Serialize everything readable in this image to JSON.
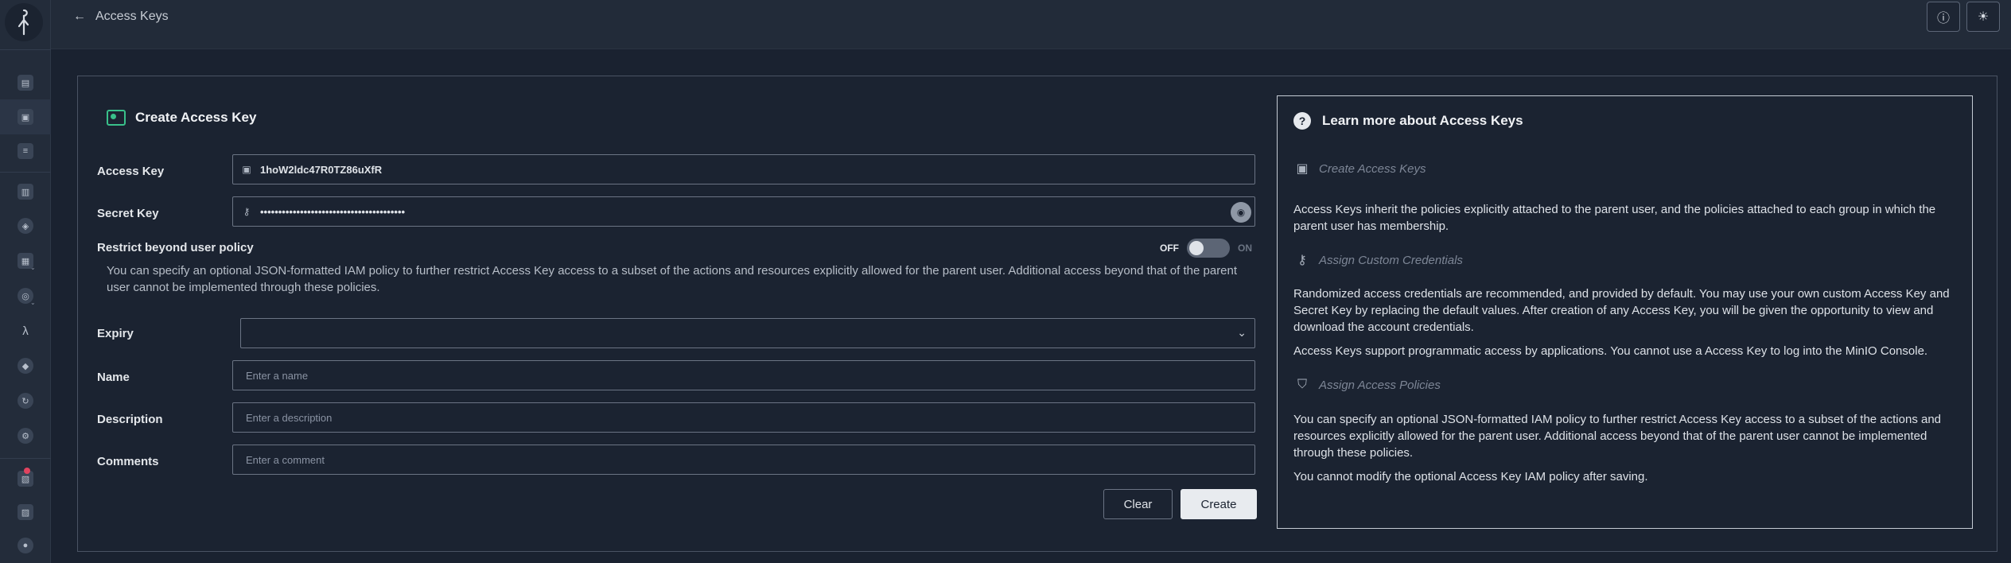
{
  "header": {
    "back_label": "Access Keys"
  },
  "form": {
    "title": "Create Access Key",
    "access_key_label": "Access Key",
    "access_key_value": "1hoW2ldc47R0TZ86uXfR",
    "secret_key_label": "Secret Key",
    "secret_key_value": "••••••••••••••••••••••••••••••••••••••••",
    "restrict_title": "Restrict beyond user policy",
    "restrict_desc": "You can specify an optional JSON-formatted IAM policy to further restrict Access Key access to a subset of the actions and resources explicitly allowed for the parent user. Additional access beyond that of the parent user cannot be implemented through these policies.",
    "toggle_off": "OFF",
    "toggle_on": "ON",
    "expiry_label": "Expiry",
    "name_label": "Name",
    "name_placeholder": "Enter a name",
    "description_label": "Description",
    "description_placeholder": "Enter a description",
    "comments_label": "Comments",
    "comments_placeholder": "Enter a comment",
    "clear_button": "Clear",
    "create_button": "Create"
  },
  "help": {
    "title": "Learn more about Access Keys",
    "section1_title": "Create Access Keys",
    "section1_p1": "Access Keys inherit the policies explicitly attached to the parent user, and the policies attached to each group in which the parent user has membership.",
    "section2_title": "Assign Custom Credentials",
    "section2_p1": "Randomized access credentials are recommended, and provided by default. You may use your own custom Access Key and Secret Key by replacing the default values. After creation of any Access Key, you will be given the opportunity to view and download the account credentials.",
    "section2_p2": "Access Keys support programmatic access by applications. You cannot use a Access Key to log into the MinIO Console.",
    "section3_title": "Assign Access Policies",
    "section3_p1": "You can specify an optional JSON-formatted IAM policy to further restrict Access Key access to a subset of the actions and resources explicitly allowed for the parent user. Additional access beyond that of the parent user cannot be implemented through these policies.",
    "section3_p2": "You cannot modify the optional Access Key IAM policy after saving."
  },
  "colors": {
    "accent_green": "#39c08a",
    "notification_red": "#e0435f"
  }
}
